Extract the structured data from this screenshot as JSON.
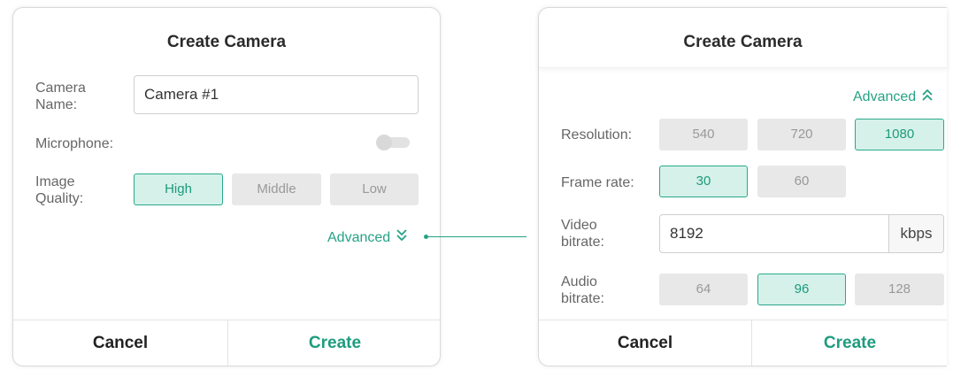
{
  "left_dialog": {
    "title": "Create Camera",
    "camera_name_label_1": "Camera",
    "camera_name_label_2": "Name:",
    "camera_name_value": "Camera #1",
    "microphone_label": "Microphone:",
    "microphone_enabled": false,
    "image_quality_label_1": "Image",
    "image_quality_label_2": "Quality:",
    "quality_options": [
      "High",
      "Middle",
      "Low"
    ],
    "quality_selected": "High",
    "advanced_label": "Advanced",
    "advanced_icon": "chevron-double-down-icon",
    "cancel_label": "Cancel",
    "create_label": "Create"
  },
  "right_dialog": {
    "title": "Create Camera",
    "advanced_label": "Advanced",
    "advanced_icon": "chevron-double-up-icon",
    "resolution_label": "Resolution:",
    "resolution_options": [
      "540",
      "720",
      "1080"
    ],
    "resolution_selected": "1080",
    "frame_rate_label": "Frame rate:",
    "frame_rate_options": [
      "30",
      "60"
    ],
    "frame_rate_selected": "30",
    "video_bitrate_label_1": "Video",
    "video_bitrate_label_2": "bitrate:",
    "video_bitrate_value": "8192",
    "video_bitrate_unit": "kbps",
    "audio_bitrate_label_1": "Audio",
    "audio_bitrate_label_2": "bitrate:",
    "audio_bitrate_options": [
      "64",
      "96",
      "128"
    ],
    "audio_bitrate_selected": "96",
    "cancel_label": "Cancel",
    "create_label": "Create"
  },
  "colors": {
    "accent": "#25a285",
    "active_fill": "#d6f1ea",
    "inactive_fill": "#e8e8e8"
  }
}
